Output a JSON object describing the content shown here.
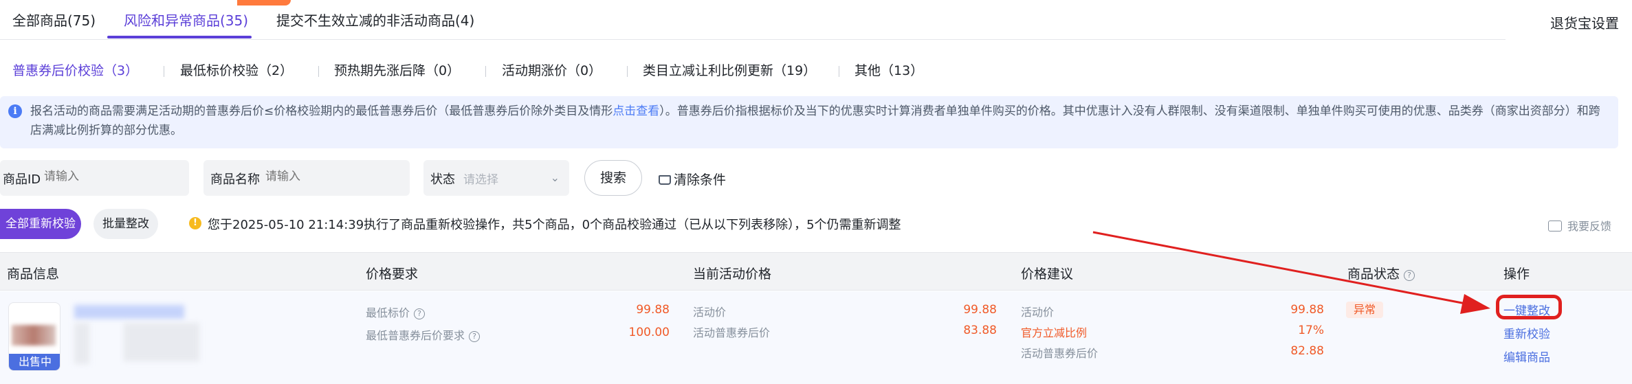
{
  "top_tabs": [
    {
      "label": "全部商品(75)"
    },
    {
      "label": "风险和异常商品(35)"
    },
    {
      "label": "提交不生效立减的非活动商品(4)"
    }
  ],
  "top_right_link": "退货宝设置",
  "sub_tabs": [
    {
      "label": "普惠券后价校验",
      "count": "（3）"
    },
    {
      "label": "最低标价校验",
      "count": "（2）"
    },
    {
      "label": "预热期先涨后降",
      "count": "（0）"
    },
    {
      "label": "活动期涨价",
      "count": "（0）"
    },
    {
      "label": "类目立减让利比例更新",
      "count": "（19）"
    },
    {
      "label": "其他",
      "count": "（13）"
    }
  ],
  "notice": {
    "text_before": "报名活动的商品需要满足活动期的普惠券后价≤价格校验期内的最低普惠券后价（最低普惠券后价除外类目及情形",
    "link": "点击查看",
    "text_after": "）。普惠券后价指根据标价及当下的优惠实时计算消费者单独单件购买的价格。其中优惠计入没有人群限制、没有渠道限制、单独单件购买可使用的优惠、品类券（商家出资部分）和跨店满减比例折算的部分优惠。"
  },
  "filters": {
    "product_id_label": "商品ID",
    "product_id_placeholder": "请输入",
    "product_name_label": "商品名称",
    "product_name_placeholder": "请输入",
    "status_label": "状态",
    "status_placeholder": "请选择",
    "search_label": "搜索",
    "clear_label": "清除条件"
  },
  "actions": {
    "recheck_all": "全部重新校验",
    "batch_fix": "批量整改",
    "message": "您于2025-05-10 21:14:39执行了商品重新校验操作，共5个商品，0个商品校验通过（已从以下列表移除），5个仍需重新调整",
    "feedback": "我要反馈"
  },
  "table": {
    "headers": {
      "product_info": "商品信息",
      "price_requirement": "价格要求",
      "current_price": "当前活动价格",
      "price_suggestion": "价格建议",
      "product_status": "商品状态",
      "operation": "操作"
    },
    "row": {
      "thumb_badge": "出售中",
      "price_requirement": [
        {
          "label": "最低标价",
          "value": "99.88"
        },
        {
          "label": "最低普惠券后价要求",
          "value": "100.00"
        }
      ],
      "current_price": [
        {
          "label": "活动价",
          "value": "99.88"
        },
        {
          "label": "活动普惠券后价",
          "value": "83.88"
        }
      ],
      "price_suggestion": [
        {
          "label": "活动价",
          "value": "99.88"
        },
        {
          "label": "官方立减比例",
          "value": "17%"
        },
        {
          "label": "活动普惠券后价",
          "value": "82.88"
        }
      ],
      "status": "异常",
      "operations": [
        "一键整改",
        "重新校验",
        "编辑商品"
      ]
    }
  },
  "colors": {
    "accent": "#5b3fd8",
    "primary_button": "#6f42d9",
    "link": "#4b6fe0",
    "price": "#f05a28",
    "annotation": "#e0201f"
  }
}
